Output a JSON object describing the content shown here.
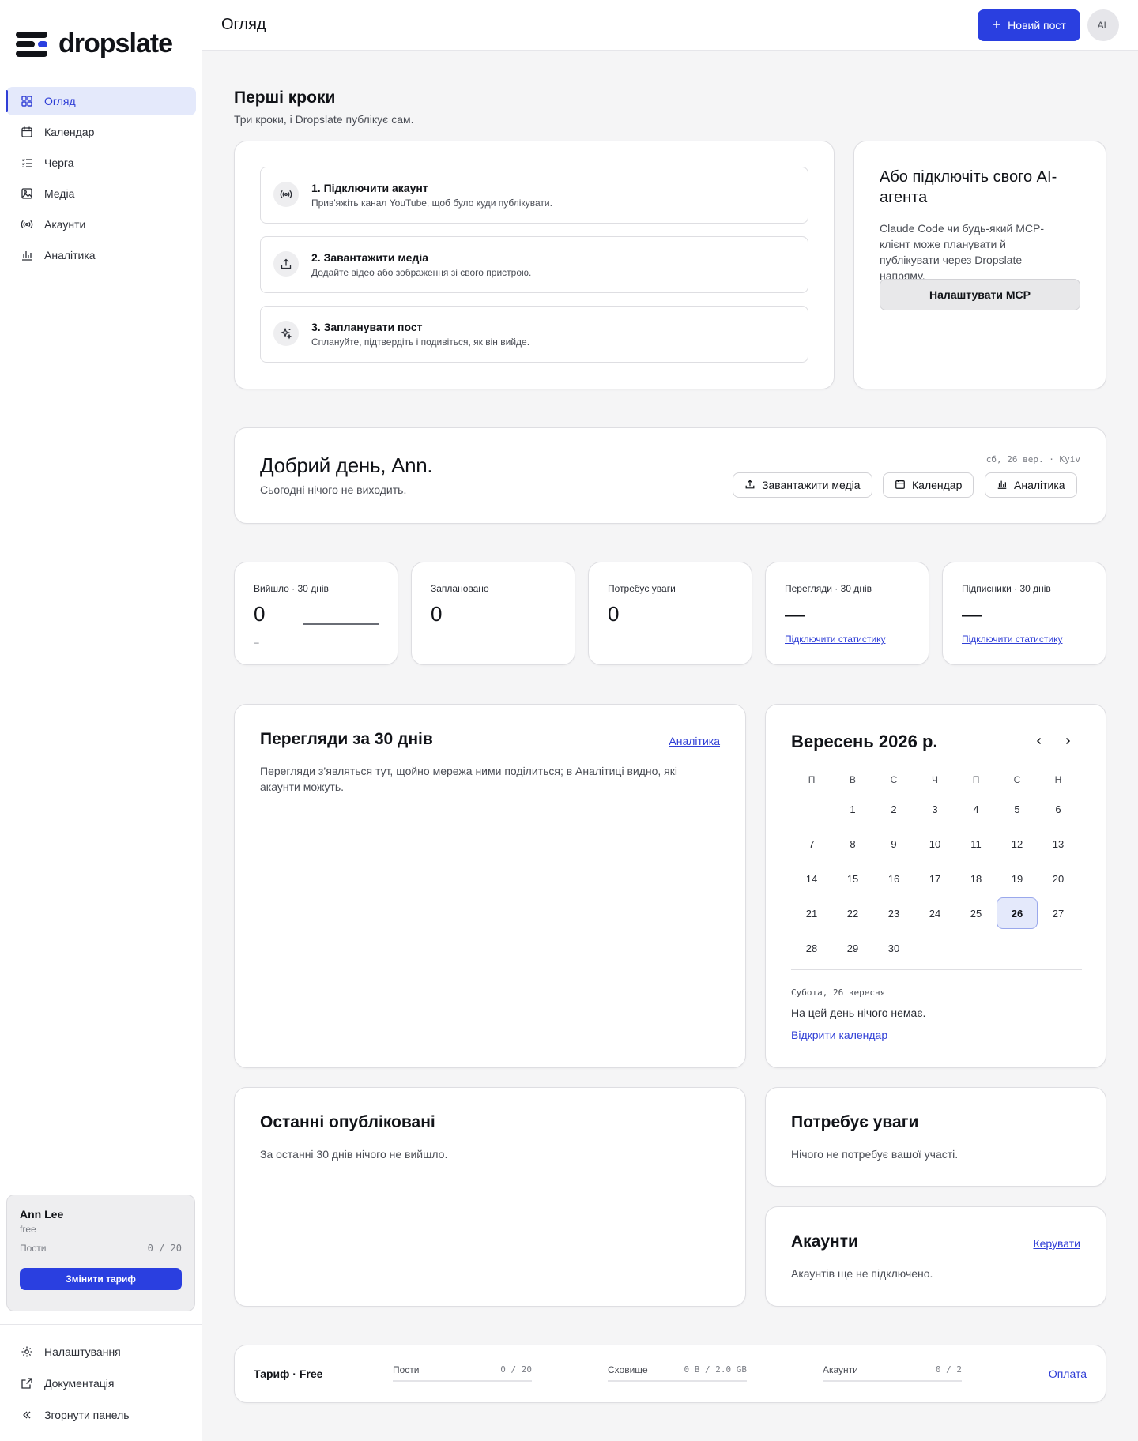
{
  "brand": {
    "name": "dropslate",
    "accent": "#2a3fe0"
  },
  "sidebar": {
    "items": [
      {
        "label": "Огляд",
        "icon": "grid-icon",
        "active": true
      },
      {
        "label": "Календар",
        "icon": "calendar-icon",
        "active": false
      },
      {
        "label": "Черга",
        "icon": "queue-icon",
        "active": false
      },
      {
        "label": "Медіа",
        "icon": "image-icon",
        "active": false
      },
      {
        "label": "Акаунти",
        "icon": "broadcast-icon",
        "active": false
      },
      {
        "label": "Аналітика",
        "icon": "bar-chart-icon",
        "active": false
      }
    ],
    "user": {
      "name": "Ann Lee",
      "tier": "free",
      "posts_label": "Пости",
      "posts_value": "0 / 20",
      "upgrade_label": "Змінити тариф"
    },
    "bottom": [
      {
        "label": "Налаштування",
        "icon": "gear-icon"
      },
      {
        "label": "Документація",
        "icon": "external-link-icon"
      },
      {
        "label": "Згорнути панель",
        "icon": "collapse-icon"
      }
    ]
  },
  "topbar": {
    "title": "Огляд",
    "new_post_label": "Новий пост",
    "avatar_initials": "AL"
  },
  "first_steps": {
    "title": "Перші кроки",
    "subtitle": "Три кроки, і Dropslate публікує сам.",
    "steps": [
      {
        "title": "1. Підключити акаунт",
        "desc": "Прив'яжіть канал YouTube, щоб було куди публікувати.",
        "icon": "broadcast-icon"
      },
      {
        "title": "2. Завантажити медіа",
        "desc": "Додайте відео або зображення зі свого пристрою.",
        "icon": "upload-icon"
      },
      {
        "title": "3. Запланувати пост",
        "desc": "Сплануйте, підтвердіть і подивіться, як він вийде.",
        "icon": "sparkle-icon"
      }
    ]
  },
  "ai_agent": {
    "title": "Або підключіть свого AI-агента",
    "desc": "Claude Code чи будь-який MCP-клієнт може планувати й публікувати через Dropslate напряму.",
    "button": "Налаштувати MCP"
  },
  "greeting": {
    "title": "Добрий день, Ann.",
    "subtitle": "Сьогодні нічого не виходить.",
    "date": "сб, 26 вер. · Kyiv",
    "actions": {
      "upload": "Завантажити медіа",
      "calendar": "Календар",
      "analytics": "Аналітика"
    }
  },
  "stats": [
    {
      "label": "Вийшло · 30 днів",
      "value": "0",
      "note": "–"
    },
    {
      "label": "Заплановано",
      "value": "0"
    },
    {
      "label": "Потребує уваги",
      "value": "0"
    },
    {
      "label": "Перегляди · 30 днів",
      "value": "—",
      "link": "Підключити статистику"
    },
    {
      "label": "Підписники · 30 днів",
      "value": "—",
      "link": "Підключити статистику"
    }
  ],
  "views_panel": {
    "title": "Перегляди за 30 днів",
    "link": "Аналітика",
    "text": "Перегляди з’являться тут, щойно мережа ними поділиться; в Аналітиці видно, які акаунти можуть."
  },
  "calendar": {
    "title": "Вересень 2026 р.",
    "weekdays": [
      "П",
      "В",
      "С",
      "Ч",
      "П",
      "С",
      "Н"
    ],
    "leading_blanks": 1,
    "days": [
      "1",
      "2",
      "3",
      "4",
      "5",
      "6",
      "7",
      "8",
      "9",
      "10",
      "11",
      "12",
      "13",
      "14",
      "15",
      "16",
      "17",
      "18",
      "19",
      "20",
      "21",
      "22",
      "23",
      "24",
      "25",
      "26",
      "27",
      "28",
      "29",
      "30"
    ],
    "today": "26",
    "selected_label": "Субота, 26 вересня",
    "empty_text": "На цей день нічого немає.",
    "open_link": "Відкрити календар"
  },
  "recent": {
    "title": "Останні опубліковані",
    "text": "За останні 30 днів нічого не вийшло."
  },
  "attention": {
    "title": "Потребує уваги",
    "text": "Нічого не потребує вашої участі."
  },
  "accounts": {
    "title": "Акаунти",
    "link": "Керувати",
    "text": "Акаунтів ще не підключено."
  },
  "footer": {
    "plan": "Тариф · Free",
    "posts": {
      "label": "Пости",
      "value": "0 / 20"
    },
    "storage": {
      "label": "Сховище",
      "value": "0 B / 2.0 GB"
    },
    "accounts": {
      "label": "Акаунти",
      "value": "0 / 2"
    },
    "link": "Оплата"
  }
}
